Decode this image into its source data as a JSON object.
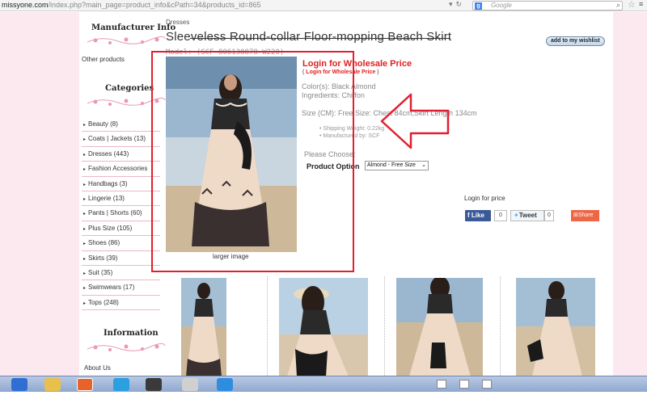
{
  "browser": {
    "url_host": "missyone.com",
    "url_path": "/index.php?main_page=product_info&cPath=34&products_id=865",
    "search_placeholder": "Google",
    "search_engine_letter": "g"
  },
  "sidebar": {
    "manufacturer_title": "Manufacturer Info",
    "other_products": "Other products",
    "categories_title": "Categories",
    "categories": [
      "Beauty (8)",
      "Coats | Jackets (13)",
      "Dresses (443)",
      "Fashion Accessories",
      "Handbags (3)",
      "Lingerie (13)",
      "Pants | Shorts (60)",
      "Plus Size (105)",
      "Shoes (86)",
      "Skirts (39)",
      "Suit (35)",
      "Swimwears (17)",
      "Tops (248)"
    ],
    "information_title": "Information",
    "about_us": "About Us"
  },
  "product": {
    "breadcrumb": "Dresses",
    "title": "Sleeveless Round-collar Floor-mopping Beach Skirt",
    "model": "Model: (SCF-806138878-W220)",
    "wishlist_button": "add to my wishlist",
    "larger_image": "larger image",
    "login_title": "Login for Wholesale Price",
    "login_sub_open": "(",
    "login_sub_link": "Login for Wholesale Price",
    "login_sub_close": ")",
    "colors": "Color(s): Black Almond",
    "ingredients": "Ingredients: Chiffon",
    "size": "Size (CM): Free Size: Chest 84cm,Skirt Length 134cm",
    "shipping_weight": "Shipping Weight: 0.22kg",
    "manufactured_by": "Manufactured by: SCF",
    "please_choose": "Please Choose:",
    "option_label": "Product Option",
    "option_selected": "Almond - Free Size",
    "login_for_price": "Login for price"
  },
  "social": {
    "facebook_label": "Like",
    "facebook_count": "0",
    "twitter_label": "Tweet",
    "twitter_count": "0",
    "share_label": "Share"
  },
  "colors": {
    "page_bg": "#fce9ef",
    "accent_red": "#e02020",
    "annotation_red": "#e02030",
    "facebook_blue": "#3b5998",
    "share_orange": "#ee6644"
  }
}
